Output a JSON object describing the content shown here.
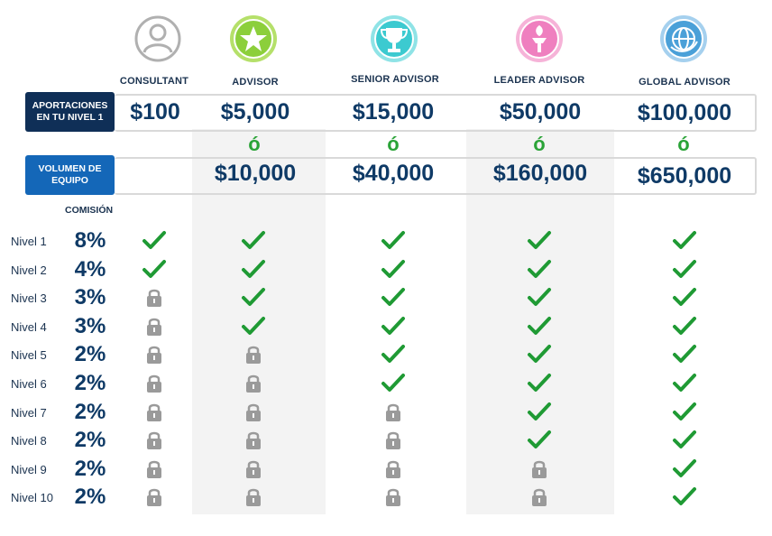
{
  "ranks": [
    {
      "label": "CONSULTANT",
      "icon": "user-icon",
      "color": "#b0b0b0"
    },
    {
      "label": "ADVISOR",
      "icon": "star-badge-icon",
      "color": "#8ccf3b"
    },
    {
      "label": "SENIOR ADVISOR",
      "icon": "trophy-badge-icon",
      "color": "#3ccad0"
    },
    {
      "label": "LEADER ADVISOR",
      "icon": "torch-badge-icon",
      "color": "#ef7fbf"
    },
    {
      "label": "GLOBAL ADVISOR",
      "icon": "globe-badge-icon",
      "color": "#4aa0d8"
    }
  ],
  "aportaciones": {
    "label": "APORTACIONES EN TU NIVEL 1",
    "values": [
      "$100",
      "$5,000",
      "$15,000",
      "$50,000",
      "$100,000"
    ]
  },
  "or_mark": "ó",
  "volumen": {
    "label": "VOLUMEN DE EQUIPO",
    "values": [
      "",
      "$10,000",
      "$40,000",
      "$160,000",
      "$650,000"
    ]
  },
  "comision_header": "COMISIÓN",
  "levels": [
    {
      "label": "Nivel 1",
      "pct": "8%",
      "status": [
        "check",
        "check",
        "check",
        "check",
        "check"
      ]
    },
    {
      "label": "Nivel 2",
      "pct": "4%",
      "status": [
        "check",
        "check",
        "check",
        "check",
        "check"
      ]
    },
    {
      "label": "Nivel 3",
      "pct": "3%",
      "status": [
        "lock",
        "check",
        "check",
        "check",
        "check"
      ]
    },
    {
      "label": "Nivel 4",
      "pct": "3%",
      "status": [
        "lock",
        "check",
        "check",
        "check",
        "check"
      ]
    },
    {
      "label": "Nivel 5",
      "pct": "2%",
      "status": [
        "lock",
        "lock",
        "check",
        "check",
        "check"
      ]
    },
    {
      "label": "Nivel 6",
      "pct": "2%",
      "status": [
        "lock",
        "lock",
        "check",
        "check",
        "check"
      ]
    },
    {
      "label": "Nivel 7",
      "pct": "2%",
      "status": [
        "lock",
        "lock",
        "lock",
        "check",
        "check"
      ]
    },
    {
      "label": "Nivel 8",
      "pct": "2%",
      "status": [
        "lock",
        "lock",
        "lock",
        "check",
        "check"
      ]
    },
    {
      "label": "Nivel 9",
      "pct": "2%",
      "status": [
        "lock",
        "lock",
        "lock",
        "lock",
        "check"
      ]
    },
    {
      "label": "Nivel 10",
      "pct": "2%",
      "status": [
        "lock",
        "lock",
        "lock",
        "lock",
        "check"
      ]
    }
  ],
  "colors": {
    "check": "#1f9a34",
    "lock": "#9a9a9a",
    "navy": "#0f2f57",
    "blue": "#1467b8"
  }
}
